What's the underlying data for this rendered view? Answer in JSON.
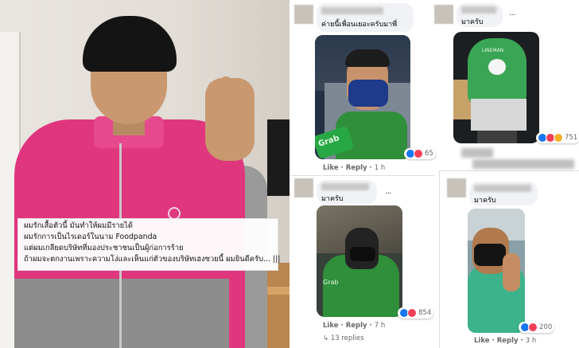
{
  "left_photo": {
    "caption_lines": [
      "ผมรักเสื้อตัวนี้ มันทำให้ผมมีรายได้",
      "ผมรักการเป็นไรเดอร์ในนาม Foodpanda",
      "แต่ผมเกลียดบริษัทที่มองประชาชนเป็นผู้ก่อการร้าย",
      "ถ้าผมจะตกงานเพราะความโง่และเห็นแก่ตัวของบริษัทเฮงซวยนี้ ผมยินดีครับ... |||"
    ]
  },
  "comments": [
    {
      "text": "ค่ายนี้เพื่อนเยอะครับมาพี่",
      "reaction_count": "65",
      "like_label": "Like",
      "reply_label": "Reply",
      "time": "1 h",
      "reactions": [
        "like-icon",
        "love-icon"
      ],
      "photo_text": "Grab"
    },
    {
      "text": "มาครับ",
      "reaction_count": "751",
      "reactions": [
        "like-icon",
        "love-icon",
        "haha-icon"
      ],
      "photo_text": "LINEMAN"
    },
    {
      "text": "มาครับ",
      "reaction_count": "854",
      "like_label": "Like",
      "reply_label": "Reply",
      "time": "7 h",
      "replies": "13 replies",
      "reactions": [
        "like-icon",
        "love-icon"
      ],
      "photo_text": "Grab"
    },
    {
      "text": "มาครับ",
      "reaction_count": "200",
      "like_label": "Like",
      "reply_label": "Reply",
      "time": "3 h",
      "reactions": [
        "like-icon",
        "love-icon"
      ]
    }
  ],
  "colors": {
    "foodpanda_pink": "#e0367e",
    "grab_green": "#2f8f3a",
    "lineman_green": "#3aa655",
    "like_blue": "#1877f2",
    "love_red": "#f33e58",
    "haha_yellow": "#f7b125"
  }
}
